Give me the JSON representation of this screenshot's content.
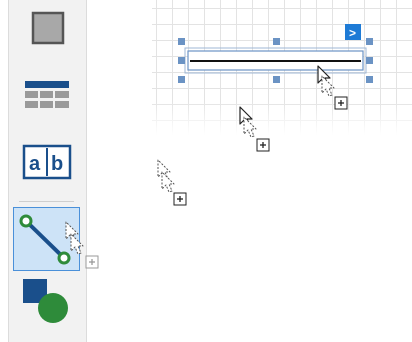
{
  "toolbox": {
    "items": [
      {
        "icon": "rectangle-icon",
        "selected": false
      },
      {
        "icon": "table-icon",
        "selected": false
      },
      {
        "icon": "label-icon",
        "selected": false,
        "glyph_left": "a",
        "glyph_right": "b"
      },
      {
        "icon": "line-icon",
        "selected": true
      },
      {
        "icon": "shapes-icon",
        "selected": false
      }
    ]
  },
  "design_surface": {
    "selected_control": "line-control",
    "smart_tag_glyph": ">"
  },
  "colors": {
    "toolbox_bg": "#f2f2f2",
    "selected_bg": "#cde3f7",
    "selected_border": "#4a90d9",
    "handle": "#6b93c4",
    "smart_tag": "#1e7bd6",
    "icon_blue": "#1a4f8b",
    "icon_green": "#2e8b3a"
  }
}
